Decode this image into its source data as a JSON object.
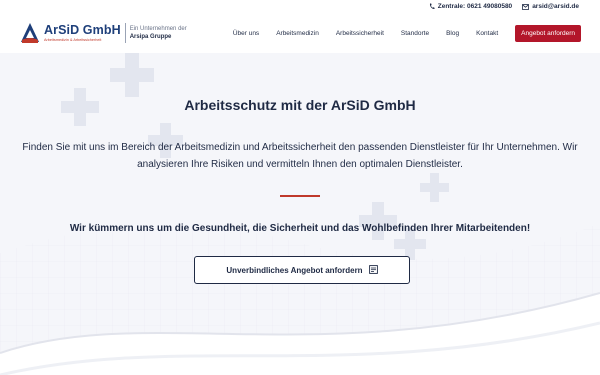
{
  "topbar": {
    "phone_label": "Zentrale: 0621 49080580",
    "email_label": "arsid@arsid.de"
  },
  "logo": {
    "name": "ArSiD GmbH",
    "tagline": "Arbeitsmedizin & Arbeitssicherheit",
    "group_line1": "Ein Unternehmen der",
    "group_line2": "Arsipa Gruppe"
  },
  "nav": {
    "items": [
      {
        "label": "Über uns"
      },
      {
        "label": "Arbeitsmedizin"
      },
      {
        "label": "Arbeitssicherheit"
      },
      {
        "label": "Standorte"
      },
      {
        "label": "Blog"
      },
      {
        "label": "Kontakt"
      }
    ],
    "cta_label": "Angebot anfordern"
  },
  "hero": {
    "title": "Arbeitsschutz mit der ArSiD GmbH",
    "text": "Finden Sie mit uns im Bereich der Arbeitsmedizin und Arbeitssicherheit den passenden Dienstleister für Ihr Unternehmen. Wir analysieren Ihre Risiken und vermitteln Ihnen den optimalen Dienstleister.",
    "subtitle": "Wir kümmern uns um die Gesundheit, die Sicherheit und das Wohlbefinden Ihrer Mitarbeitenden!",
    "button_label": "Unverbindliches Angebot anfordern"
  },
  "colors": {
    "brand_blue": "#1e3f7a",
    "accent_red": "#b3162a",
    "text_dark": "#1f2a44"
  },
  "icons": {
    "phone": "phone-icon",
    "email": "envelope-icon",
    "button": "form-icon",
    "background": "medical-cross-icon"
  }
}
